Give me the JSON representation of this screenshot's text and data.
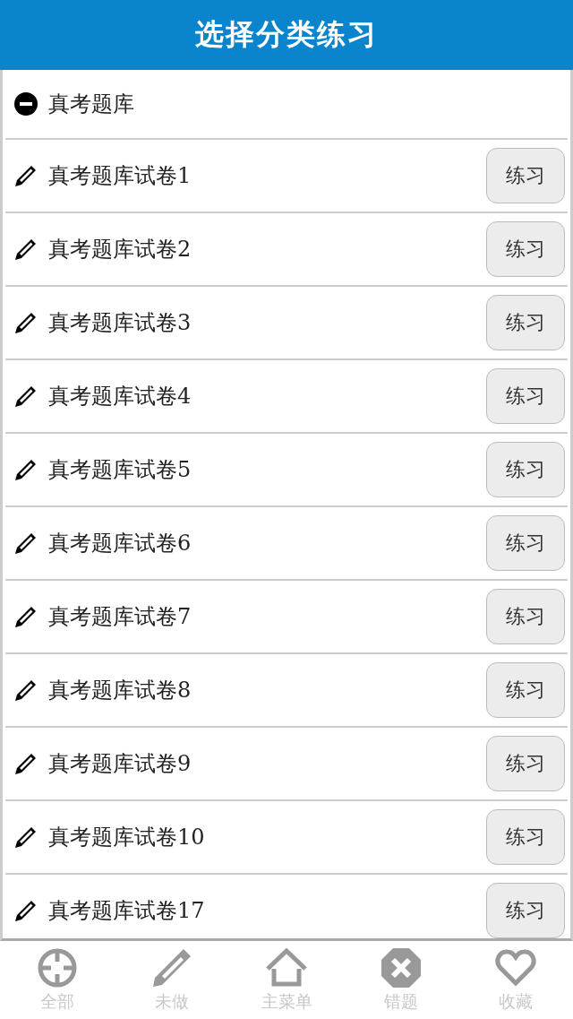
{
  "header": {
    "title": "选择分类练习"
  },
  "category": {
    "label": "真考题库",
    "expanded": true
  },
  "papers": [
    {
      "label": "真考题库试卷1",
      "button": "练习"
    },
    {
      "label": "真考题库试卷2",
      "button": "练习"
    },
    {
      "label": "真考题库试卷3",
      "button": "练习"
    },
    {
      "label": "真考题库试卷4",
      "button": "练习"
    },
    {
      "label": "真考题库试卷5",
      "button": "练习"
    },
    {
      "label": "真考题库试卷6",
      "button": "练习"
    },
    {
      "label": "真考题库试卷7",
      "button": "练习"
    },
    {
      "label": "真考题库试卷8",
      "button": "练习"
    },
    {
      "label": "真考题库试卷9",
      "button": "练习"
    },
    {
      "label": "真考题库试卷10",
      "button": "练习"
    },
    {
      "label": "真考题库试卷17",
      "button": "练习"
    }
  ],
  "bottom_nav": [
    {
      "kind": "crosshair",
      "label": "全部"
    },
    {
      "kind": "pencil",
      "label": "未做"
    },
    {
      "kind": "home",
      "label": "主菜单"
    },
    {
      "kind": "wrong",
      "label": "错题"
    },
    {
      "kind": "heart",
      "label": "收藏"
    }
  ]
}
